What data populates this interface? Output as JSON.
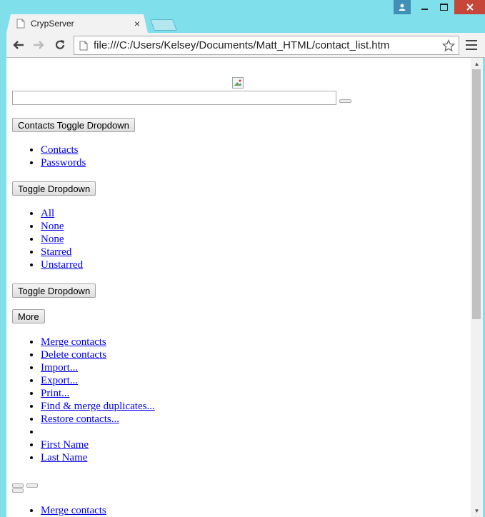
{
  "browser": {
    "tab_title": "CrypServer",
    "tab_close": "×",
    "url": "file:///C:/Users/Kelsey/Documents/Matt_HTML/contact_list.htm"
  },
  "page": {
    "search": {
      "value": ""
    },
    "contacts_toggle_label": "Contacts Toggle Dropdown",
    "contacts_menu": [
      "Contacts",
      "Passwords"
    ],
    "select_toggle_label": "Toggle Dropdown",
    "select_menu": [
      "All",
      "None",
      "None",
      "Starred",
      "Unstarred"
    ],
    "toggle_label_2": "Toggle Dropdown",
    "more_label": "More",
    "more_menu": [
      "Merge contacts",
      "Delete contacts",
      "Import...",
      "Export...",
      "Print...",
      "Find & merge duplicates...",
      "Restore contacts...",
      "",
      "First Name",
      "Last Name"
    ],
    "bottom_menu": [
      "Merge contacts"
    ]
  },
  "colors": {
    "link": "#0000ee",
    "close_button": "#c7463a",
    "frame": "#7fdfeb"
  }
}
